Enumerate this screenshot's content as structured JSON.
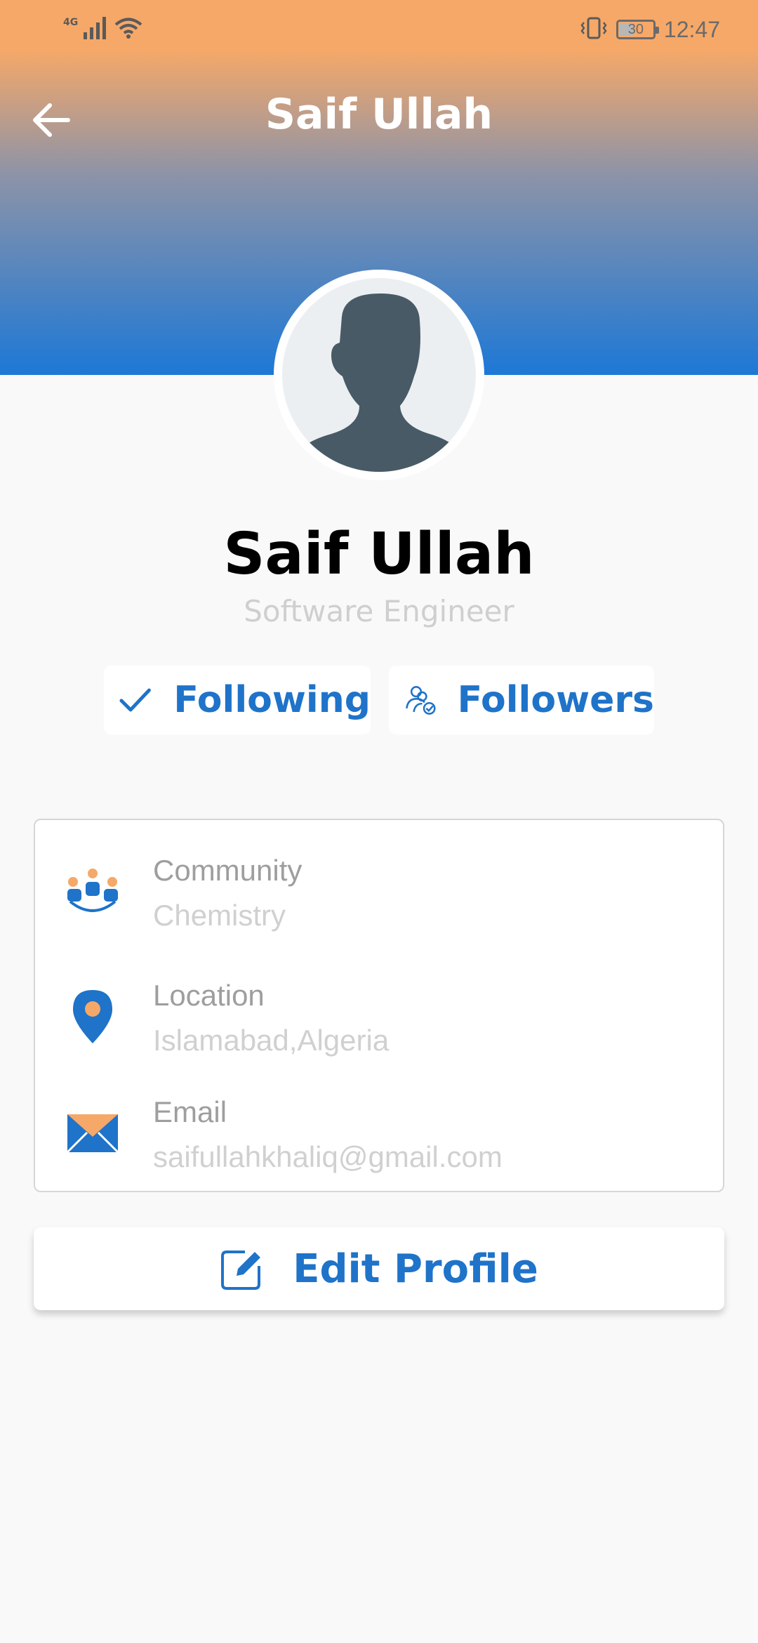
{
  "status_bar": {
    "network": "4G",
    "battery": "30",
    "time": "12:47"
  },
  "header": {
    "title": "Saif Ullah"
  },
  "profile": {
    "name": "Saif Ullah",
    "role": "Software Engineer"
  },
  "buttons": {
    "following": "Following",
    "followers": "Followers",
    "edit_profile": "Edit Profile"
  },
  "info": [
    {
      "label": "Community",
      "value": "Chemistry",
      "icon": "community-icon"
    },
    {
      "label": "Location",
      "value": "Islamabad,Algeria",
      "icon": "location-pin-icon"
    },
    {
      "label": "Email",
      "value": "saifullahkhaliq@gmail.com",
      "icon": "email-icon"
    }
  ],
  "colors": {
    "accent_blue": "#1f73c9",
    "accent_orange": "#f6a868",
    "header_bottom": "#1d78d6"
  }
}
